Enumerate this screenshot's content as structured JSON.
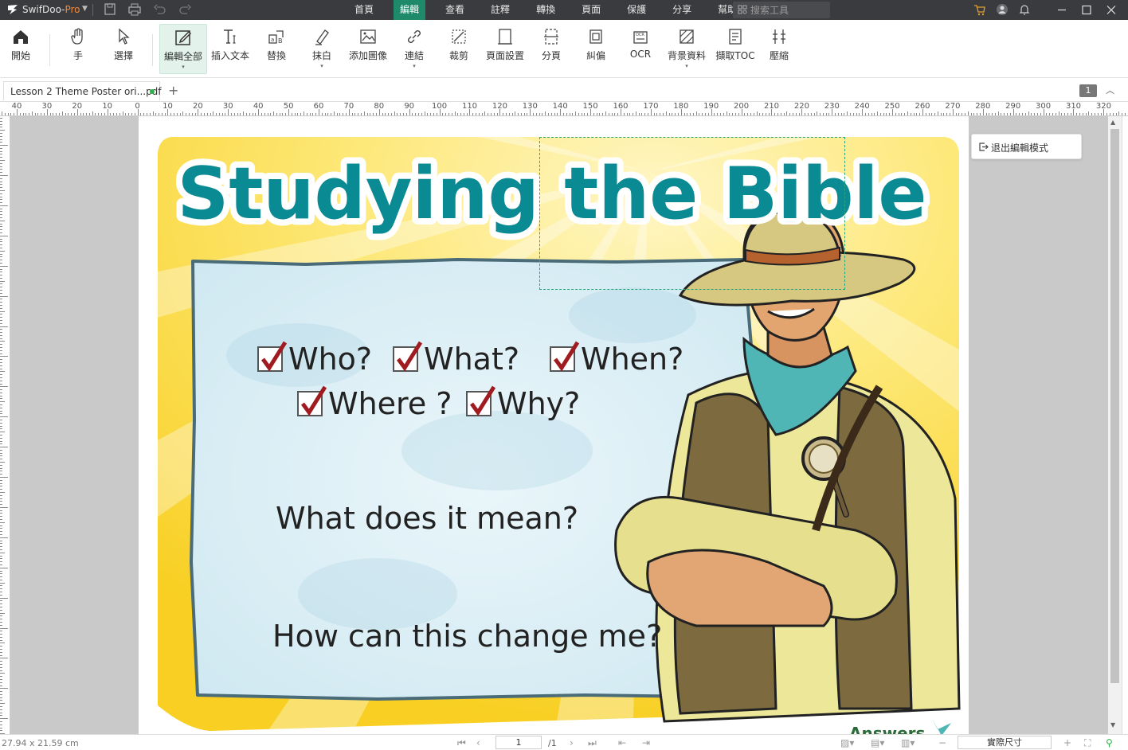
{
  "app": {
    "name": "SwifDoo-",
    "name_suffix": "Pro"
  },
  "menu": {
    "tabs": [
      "首頁",
      "編輯",
      "查看",
      "註釋",
      "轉換",
      "頁面",
      "保護",
      "分享",
      "幫助"
    ],
    "active_index": 1
  },
  "search": {
    "placeholder": "搜索工具"
  },
  "ribbon": {
    "items": [
      {
        "label": "開始",
        "icon": "home-icon"
      },
      {
        "label": "手",
        "icon": "hand-icon"
      },
      {
        "label": "選擇",
        "icon": "select-cursor-icon"
      },
      {
        "label": "編輯全部",
        "icon": "edit-all-icon",
        "active": true,
        "dropdown": true
      },
      {
        "label": "插入文本",
        "icon": "insert-text-icon"
      },
      {
        "label": "替換",
        "icon": "replace-icon"
      },
      {
        "label": "抹白",
        "icon": "whiteout-icon",
        "dropdown": true
      },
      {
        "label": "添加圖像",
        "icon": "add-image-icon"
      },
      {
        "label": "連結",
        "icon": "link-icon",
        "dropdown": true
      },
      {
        "label": "裁剪",
        "icon": "crop-icon"
      },
      {
        "label": "頁面設置",
        "icon": "page-setup-icon"
      },
      {
        "label": "分頁",
        "icon": "split-page-icon"
      },
      {
        "label": "糾偏",
        "icon": "deskew-icon"
      },
      {
        "label": "OCR",
        "icon": "ocr-icon"
      },
      {
        "label": "背景資料",
        "icon": "background-icon",
        "dropdown": true
      },
      {
        "label": "擷取TOC",
        "icon": "extract-toc-icon"
      },
      {
        "label": "壓縮",
        "icon": "compress-icon"
      }
    ]
  },
  "document": {
    "tab_label": "Lesson 2 Theme Poster ori...pdf",
    "page_badge": "1"
  },
  "ruler": {
    "labels": [
      "40",
      "30",
      "20",
      "10",
      "0",
      "10",
      "20",
      "30",
      "40",
      "50",
      "60",
      "70",
      "80",
      "90",
      "100",
      "110",
      "120",
      "130",
      "140",
      "150",
      "160",
      "170",
      "180",
      "190",
      "200",
      "210",
      "220",
      "230",
      "240",
      "250",
      "260",
      "270",
      "280",
      "290",
      "300",
      "310",
      "320"
    ]
  },
  "poster": {
    "title": "Studying the Bible",
    "questions": [
      "Who?",
      "What?",
      "When?",
      "Where ?",
      "Why?"
    ],
    "line1": "What does it mean?",
    "line2": "How can this change me?",
    "logo_text": "Answers",
    "colors": {
      "title": "#0a8a93",
      "sun": "#fbd93a",
      "scroll": "#d9eef4",
      "check": "#a01b20"
    }
  },
  "edit_mode": {
    "exit_label": "退出編輯模式"
  },
  "status": {
    "page_size": "27.94 x 21.59 cm",
    "current_page": "1",
    "total_pages": "/1",
    "zoom": "實際尺寸"
  },
  "colors": {
    "accent": "#1f8a6a",
    "titlebar": "#3a3b3e"
  }
}
